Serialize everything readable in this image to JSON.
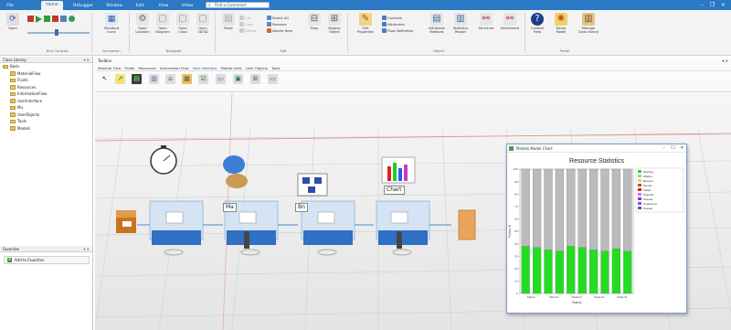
{
  "titlebar": {
    "tabs": [
      "File",
      "Home",
      "Debugger",
      "Window",
      "Edit",
      "View",
      "Video"
    ],
    "active_tab": "Home",
    "search_placeholder": "Find a Command"
  },
  "ribbon": {
    "open_label": "Open",
    "run_controls_group": "Run Controls",
    "animation": {
      "label": "Standard Icons",
      "group": "Animation"
    },
    "navigate": {
      "labels": [
        "Open Location",
        "Open Diagram",
        "Open Class",
        "Open 2D/3D"
      ],
      "group": "Navigate"
    },
    "edit": {
      "labels": [
        "Paste",
        "Cut",
        "Copy",
        "Delete",
        "Select All",
        "Rename",
        "Delete Item",
        "Snap",
        "Display Object"
      ],
      "group": "Edit"
    },
    "object": {
      "labels": [
        "Edit Properties",
        "Controls",
        "Attributes",
        "Flow Definition",
        "Attributes Methods",
        "Statistics Report",
        "Structure",
        "Inheritance"
      ],
      "group": "Object"
    },
    "portal": {
      "labels": [
        "Context Help",
        "Demo Model",
        "Manage Class library"
      ],
      "group": "Portal"
    }
  },
  "class_library": {
    "title": "Class Library",
    "root": "Basis",
    "items": [
      "MaterialFlow",
      "Fluids",
      "Resources",
      "InformationFlow",
      "UserInterface",
      "Mu",
      "UserObjects",
      "Tools",
      "Models"
    ]
  },
  "favorites": {
    "title": "Favorites",
    "add_label": "Add to Favorites"
  },
  "toolbox": {
    "title": "Toolbox",
    "tabs": [
      "Material Flow",
      "Fluids",
      "Resources",
      "Information Flow",
      "User Interface",
      "Mobile Units",
      "User Objects",
      "Tools"
    ],
    "active_tab": "User Interface"
  },
  "canvas": {
    "station_labels": [
      "Ma",
      "Bn",
      "Chart"
    ]
  },
  "stats_window": {
    "title": "Models.Model.Chart",
    "chart_title": "Resource Statistics"
  },
  "chart_data": {
    "type": "bar",
    "title": "Resource Statistics",
    "xlabel": "Objects",
    "ylabel": "Portion %",
    "ylim": [
      0,
      100
    ],
    "categories": [
      "Station",
      "",
      "Station1",
      "",
      "Station2",
      "",
      "Station3",
      "",
      "Station4",
      ""
    ],
    "series": [
      {
        "name": "Working",
        "color": "#22dd22",
        "values": [
          38,
          37,
          35,
          34,
          38,
          37,
          35,
          34,
          36,
          34
        ]
      },
      {
        "name": "Waiting",
        "color": "#bbbbbb",
        "values": [
          62,
          63,
          65,
          66,
          62,
          63,
          65,
          66,
          64,
          66
        ]
      }
    ],
    "legend": [
      "Working",
      "Waiting",
      "Blocked",
      "Set-Up",
      "Failed",
      "Stopped",
      "Paused",
      "Unplanned",
      "Paused"
    ],
    "legend_colors": [
      "#22dd22",
      "#bbbbbb",
      "#f0e030",
      "#8a6a2a",
      "#e02020",
      "#ff66cc",
      "#3355ff",
      "#bf3fbf",
      "#2b6fd6"
    ]
  }
}
